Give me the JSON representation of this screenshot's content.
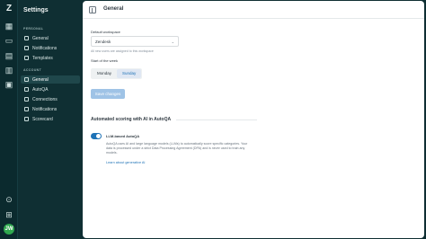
{
  "rail": {
    "logo": "Z",
    "icons": [
      "dashboard-icon",
      "inbox-icon",
      "chart-icon",
      "book-icon",
      "tickets-icon",
      "courses-icon",
      "help-icon",
      "apps-grid-icon"
    ],
    "avatar_initials": "JW",
    "avatar_color": "#2fa84f"
  },
  "sidebar": {
    "title": "Settings",
    "personal_header": "PERSONAL",
    "personal_items": [
      {
        "label": "General"
      },
      {
        "label": "Notifications"
      },
      {
        "label": "Templates"
      }
    ],
    "account_header": "ACCOUNT",
    "account_items": [
      {
        "label": "General",
        "active": true
      },
      {
        "label": "AutoQA"
      },
      {
        "label": "Connections"
      },
      {
        "label": "Notifications"
      },
      {
        "label": "Scorecard"
      }
    ]
  },
  "header": {
    "title": "General"
  },
  "workspace": {
    "label": "Default workspace",
    "value": "Zendesk",
    "hint": "All new users are assigned to this workspace"
  },
  "week": {
    "label": "Start of the week",
    "options": [
      "Monday",
      "Sunday"
    ],
    "selected": "Sunday"
  },
  "save_label": "Save changes",
  "autoqa": {
    "section_title": "Automated scoring with AI in AutoQA",
    "toggle_label": "LLM-based AutoQA",
    "toggle_on": true,
    "description": "AutoQA uses AI and large language models (LLMs) to automatically score specific categories. Your data is processed under a strict Data Processing Agreement (DPA) and is never used to train any models.",
    "link": "Learn about generative AI"
  },
  "colors": {
    "accent": "#1f73b7",
    "sidebar_bg": "#0f2f33"
  }
}
